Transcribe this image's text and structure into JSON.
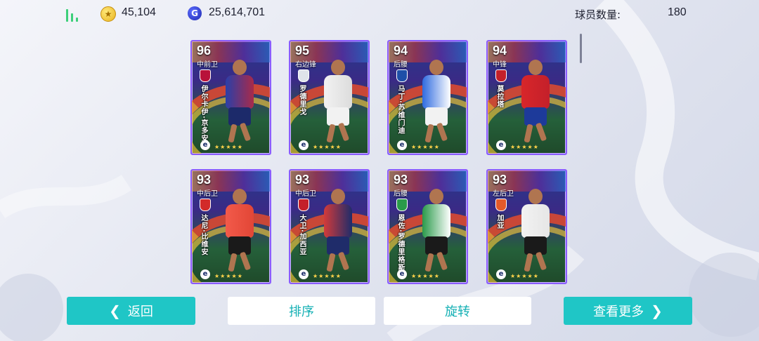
{
  "header": {
    "coins": "45,104",
    "gp": "25,614,701",
    "player_count_label": "球员数量:",
    "player_count": "180",
    "coin_icon_glyph": "★",
    "gp_icon_glyph": "G"
  },
  "cards": [
    {
      "rating": "96",
      "position": "中前卫",
      "name": "伊尔卡伊·京多安",
      "kit": "#2b3fa8",
      "kit2": "#a82a4a",
      "shorts": "#1c2a6a",
      "badge": "#b8123a",
      "logo": "e",
      "stars": "★★★★★"
    },
    {
      "rating": "95",
      "position": "右边锋",
      "name": "罗德里戈",
      "kit": "#f2f2f2",
      "kit2": "#dcdcdc",
      "shorts": "#f2f2f2",
      "badge": "#dfe3ea",
      "logo": "e",
      "stars": "★★★★★"
    },
    {
      "rating": "94",
      "position": "后腰",
      "name": "马丁·苏维门迪",
      "kit": "#2f6be0",
      "kit2": "#ffffff",
      "shorts": "#f2f2f2",
      "badge": "#1e4fa8",
      "logo": "e",
      "stars": "★★★★★"
    },
    {
      "rating": "94",
      "position": "中锋",
      "name": "莫拉塔",
      "kit": "#d8262a",
      "kit2": "#c4202a",
      "shorts": "#1d3a9a",
      "badge": "#c4202a",
      "logo": "e",
      "stars": "★★★★★"
    },
    {
      "rating": "93",
      "position": "中后卫",
      "name": "达尼·比维安",
      "kit": "#f25a4a",
      "kit2": "#e24636",
      "shorts": "#1a1a1a",
      "badge": "#d22a2a",
      "logo": "e",
      "stars": "★★★★★"
    },
    {
      "rating": "93",
      "position": "中后卫",
      "name": "大卫·加西亚",
      "kit": "#d23a3a",
      "kit2": "#1f2c6a",
      "shorts": "#1f2c6a",
      "badge": "#c4202a",
      "logo": "e",
      "stars": "★★★★★"
    },
    {
      "rating": "93",
      "position": "后腰",
      "name": "恩佐·罗德里格斯",
      "kit": "#2a9a4a",
      "kit2": "#ffffff",
      "shorts": "#1a1a1a",
      "badge": "#2a9a4a",
      "logo": "e",
      "stars": "★★★★★"
    },
    {
      "rating": "93",
      "position": "左后卫",
      "name": "加亚",
      "kit": "#f2f2f2",
      "kit2": "#e6e6e6",
      "shorts": "#1a1a1a",
      "badge": "#e35a2a",
      "logo": "e",
      "stars": "★★★★★"
    }
  ],
  "buttons": {
    "back": "返回",
    "sort": "排序",
    "rotate": "旋转",
    "view_more": "查看更多",
    "back_chevron": "❮",
    "more_chevron": "❯"
  }
}
